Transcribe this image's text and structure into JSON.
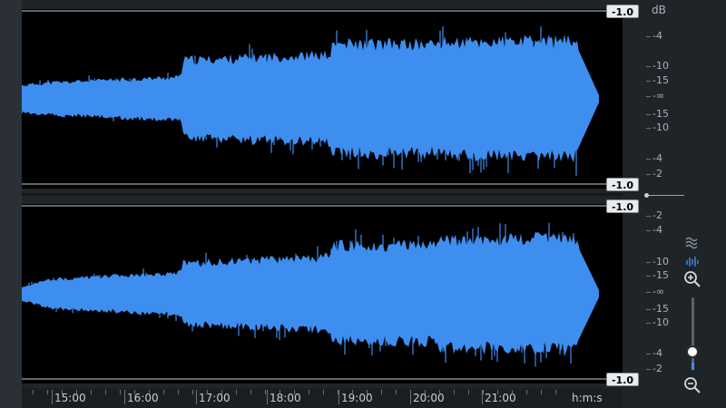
{
  "clip_labels": {
    "top_upper": "-1.0",
    "top_lower": "-1.0",
    "bottom_upper": "-1.0",
    "bottom_lower": "-1.0"
  },
  "db_scale": {
    "unit": "dB",
    "top_channel": [
      "-4",
      "-10",
      "-15",
      "-∞",
      "-15",
      "-10",
      "-4",
      "-2"
    ],
    "bottom_channel": [
      "-2",
      "-4",
      "-10",
      "-15",
      "-∞",
      "-15",
      "-10",
      "-4",
      "-2"
    ]
  },
  "timeline": {
    "labels": [
      "15:00",
      "16:00",
      "17:00",
      "18:00",
      "19:00",
      "20:00",
      "21:00"
    ],
    "unit": "h:m:s"
  },
  "tools": {
    "spectrogram_icon": "spectrogram-icon",
    "waveform_icon": "waveform-icon",
    "zoom_in_icon": "zoom-in-icon",
    "zoom_out_icon": "zoom-out-icon"
  },
  "zoom_level": 0.25,
  "colors": {
    "waveform": "#3e8ef0",
    "background": "#000000",
    "panel": "#1f2428"
  }
}
